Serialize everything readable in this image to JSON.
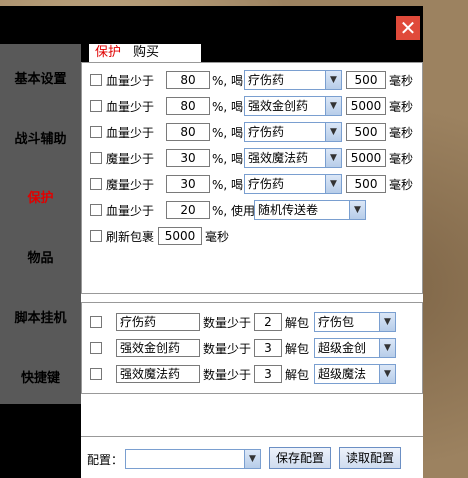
{
  "close_label": "✕",
  "sidebar": {
    "items": [
      {
        "label": "基本设置"
      },
      {
        "label": "战斗辅助"
      },
      {
        "label": "保护"
      },
      {
        "label": "物品"
      },
      {
        "label": "脚本挂机"
      },
      {
        "label": "快捷键"
      }
    ],
    "active_index": 2
  },
  "tabs": [
    {
      "label": "保护"
    },
    {
      "label": "购买"
    }
  ],
  "protect": {
    "rows": [
      {
        "label": "血量少于",
        "value": "80",
        "unit": "%, 喝",
        "item": "疗伤药",
        "ms": "500",
        "ms_unit": "毫秒"
      },
      {
        "label": "血量少于",
        "value": "80",
        "unit": "%, 喝",
        "item": "强效金创药",
        "ms": "5000",
        "ms_unit": "毫秒"
      },
      {
        "label": "血量少于",
        "value": "80",
        "unit": "%, 喝",
        "item": "疗伤药",
        "ms": "500",
        "ms_unit": "毫秒"
      },
      {
        "label": "魔量少于",
        "value": "30",
        "unit": "%, 喝",
        "item": "强效魔法药",
        "ms": "5000",
        "ms_unit": "毫秒"
      },
      {
        "label": "魔量少于",
        "value": "30",
        "unit": "%, 喝",
        "item": "疗伤药",
        "ms": "500",
        "ms_unit": "毫秒"
      }
    ],
    "teleport": {
      "label": "血量少于",
      "value": "20",
      "unit": "%, 使用",
      "item": "随机传送卷"
    },
    "refresh": {
      "label": "刷新包裹",
      "value": "5000",
      "unit": "毫秒"
    }
  },
  "unpack": {
    "rows": [
      {
        "item": "疗伤药",
        "mid": "数量少于",
        "count": "2",
        "action": "解包",
        "pack": "疗伤包"
      },
      {
        "item": "强效金创药",
        "mid": "数量少于",
        "count": "3",
        "action": "解包",
        "pack": "超级金创"
      },
      {
        "item": "强效魔法药",
        "mid": "数量少于",
        "count": "3",
        "action": "解包",
        "pack": "超级魔法"
      }
    ]
  },
  "footer": {
    "config_label": "配置：",
    "config_value": "",
    "save_label": "保存配置",
    "load_label": "读取配置"
  },
  "colors": {
    "active": "#e00000",
    "close_bg": "#e04a3a",
    "sidebar_bg": "#595959"
  }
}
